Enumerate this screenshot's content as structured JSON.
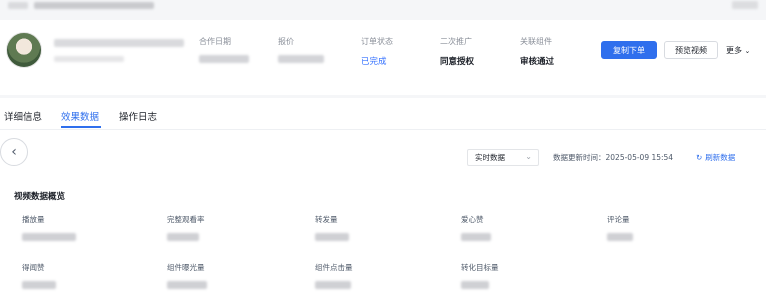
{
  "info": {
    "cooperation_date_label": "合作日期",
    "price_label": "报价",
    "order_status_label": "订单状态",
    "order_status_value": "已完成",
    "secondary_promo_label": "二次推广",
    "secondary_promo_value": "同意授权",
    "linked_component_label": "关联组件",
    "linked_component_value": "审核通过"
  },
  "actions": {
    "place_order": "复制下单",
    "preview_video": "预览视频",
    "more": "更多"
  },
  "tabs": [
    "详细信息",
    "效果数据",
    "操作日志"
  ],
  "toolbar": {
    "select_value": "实时数据",
    "update_time": "数据更新时间：2025-05-09 15:54",
    "refresh": "刷新数据"
  },
  "section": {
    "title": "视频数据概览",
    "metrics": [
      "播放量",
      "完整观看率",
      "转发量",
      "爱心赞",
      "评论量",
      "得闻赞",
      "组件曝光量",
      "组件点击量",
      "转化目标量"
    ]
  },
  "colors": {
    "primary": "#2f6fed",
    "status_done": "#3370ff"
  }
}
